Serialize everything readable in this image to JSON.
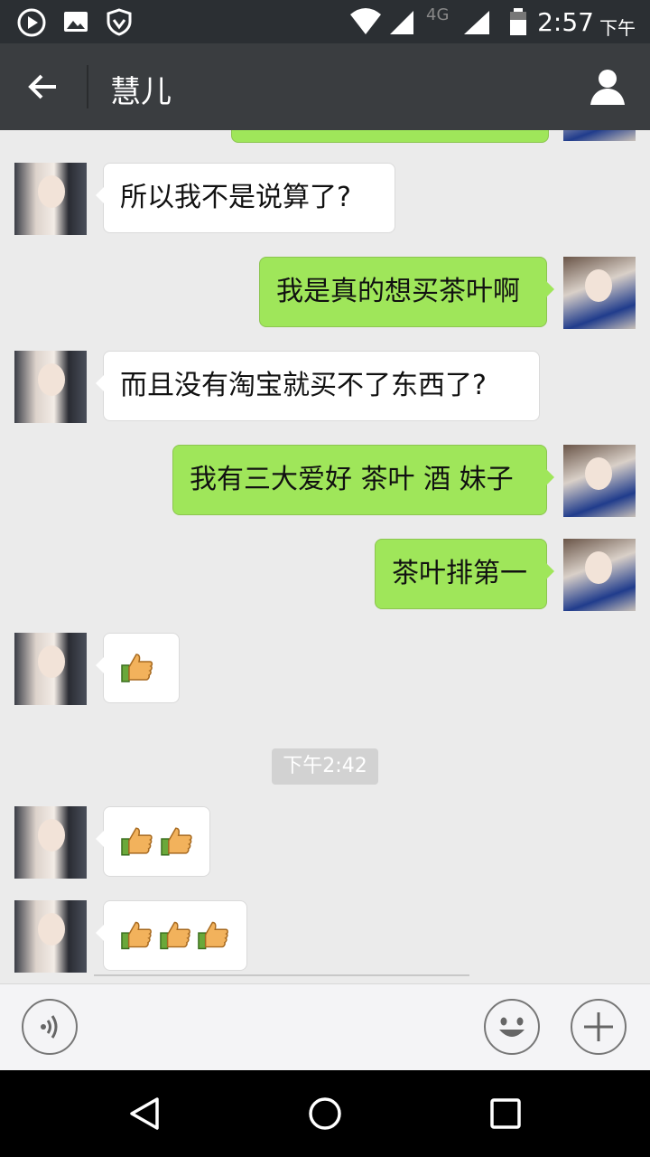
{
  "status_bar": {
    "network": "4G",
    "time": "2:57",
    "ampm": "下午"
  },
  "header": {
    "contact_name": "慧儿"
  },
  "messages": [
    {
      "from": "her",
      "text": "所以我不是说算了?"
    },
    {
      "from": "me",
      "text": "我是真的想买茶叶啊"
    },
    {
      "from": "her",
      "text": "而且没有淘宝就买不了东西了?"
    },
    {
      "from": "me",
      "text": "我有三大爱好 茶叶 酒 妹子"
    },
    {
      "from": "me",
      "text": "茶叶排第一"
    },
    {
      "from": "her",
      "thumbs_up_count": 1
    },
    {
      "from": "her",
      "thumbs_up_count": 2
    },
    {
      "from": "her",
      "thumbs_up_count": 3
    }
  ],
  "timestamp_divider": "下午2:42",
  "colors": {
    "outgoing_bubble": "#9fe65a",
    "incoming_bubble": "#ffffff",
    "header_bg": "#3a3d40"
  },
  "icons": {
    "back": "arrow-left-icon",
    "profile": "person-icon",
    "voice": "voice-icon",
    "emoji": "smiley-icon",
    "more": "plus-icon"
  }
}
